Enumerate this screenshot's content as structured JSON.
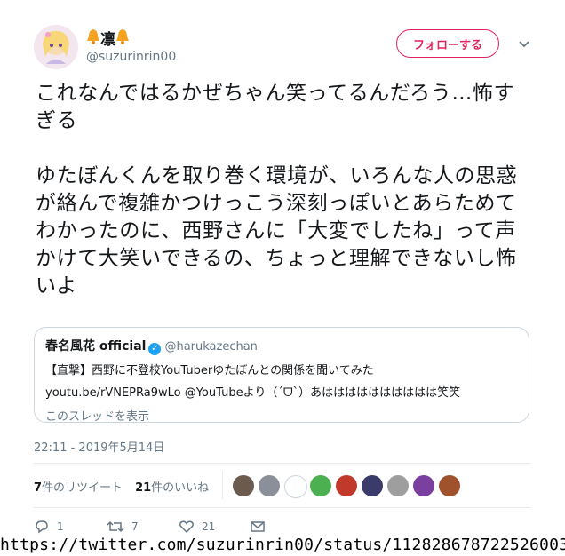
{
  "user": {
    "display_name_text": "凛",
    "handle": "@suzurinrin00",
    "follow_label": "フォローする"
  },
  "tweet": {
    "paragraph1": "これなんではるかぜちゃん笑ってるんだろう…怖すぎる",
    "paragraph2": "ゆたぼんくんを取り巻く環境が、いろんな人の思惑が絡んで複雑かつけっこう深刻っぽいとあらためてわかったのに、西野さんに「大変でしたね」って声かけて大笑いできるの、ちょっと理解できないし怖いよ"
  },
  "quote": {
    "author": "春名風花 official",
    "handle": "@harukazechan",
    "line1": "【直撃】西野に不登校YouTuberゆたぼんとの関係を聞いてみた",
    "line2": "youtu.be/rVNEPRa9wLo @YouTubeより（´ᗜ`）あはははははははははは笑笑",
    "thread_link": "このスレッドを表示"
  },
  "timestamp": "22:11 - 2019年5月14日",
  "stats": {
    "retweets_count": "7",
    "retweets_label": "件のリツイート",
    "likes_count": "21",
    "likes_label": "件のいいね"
  },
  "actions": {
    "reply_count": "1",
    "retweet_count": "7",
    "like_count": "21"
  },
  "likers_colors": [
    "#6b5a4e",
    "#8a8f99",
    "#ffffff",
    "#4caf50",
    "#c0392b",
    "#3b3b6b",
    "#9e9e9e",
    "#7b3fa0",
    "#a0522d"
  ],
  "status_url": "https://twitter.com/suzurinrin00/status/1128286787225260034"
}
